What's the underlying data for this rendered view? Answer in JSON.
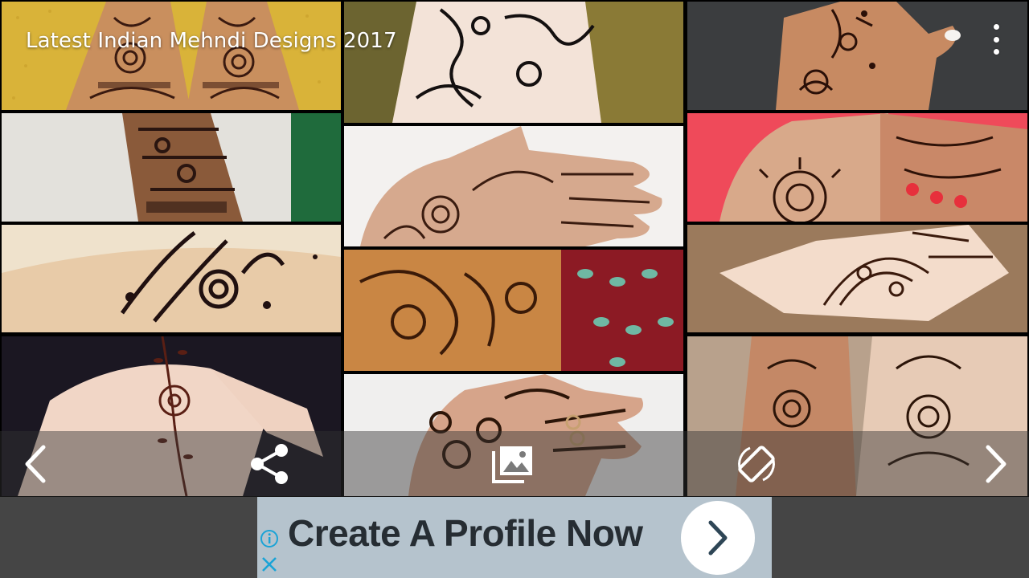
{
  "app": {
    "title": "Latest Indian Mehndi Designs 2017",
    "menu_icon": "more-vert-icon"
  },
  "gallery": {
    "tiles": [
      {
        "name": "mehndi-photo-1",
        "desc": "both hands yellow cloth"
      },
      {
        "name": "mehndi-photo-2",
        "desc": "fingers paisley"
      },
      {
        "name": "mehndi-photo-3",
        "desc": "hand with white nails"
      },
      {
        "name": "mehndi-photo-4",
        "desc": "wrist white cloth"
      },
      {
        "name": "mehndi-photo-5",
        "desc": "palm full design"
      },
      {
        "name": "mehndi-photo-6",
        "desc": "wrist sun pink background"
      },
      {
        "name": "mehndi-photo-7",
        "desc": "arm paisley"
      },
      {
        "name": "mehndi-photo-8",
        "desc": "bridal red fabric"
      },
      {
        "name": "mehndi-photo-9",
        "desc": "hand arch cuff"
      },
      {
        "name": "mehndi-photo-10",
        "desc": "flower vine hand"
      },
      {
        "name": "mehndi-photo-11",
        "desc": "palm rings"
      },
      {
        "name": "mehndi-photo-12",
        "desc": "two hands floral"
      }
    ]
  },
  "controls": {
    "prev_icon": "chevron-left-icon",
    "share_icon": "share-icon",
    "wallpaper_icon": "image-gallery-icon",
    "rotate_icon": "screen-rotation-icon",
    "next_icon": "chevron-right-icon"
  },
  "ad": {
    "headline": "Create A Profile Now",
    "info_icon": "info-icon",
    "close_icon": "close-icon",
    "cta_icon": "chevron-right-icon",
    "background": "#b5c3cd",
    "text_color": "#262d33"
  }
}
